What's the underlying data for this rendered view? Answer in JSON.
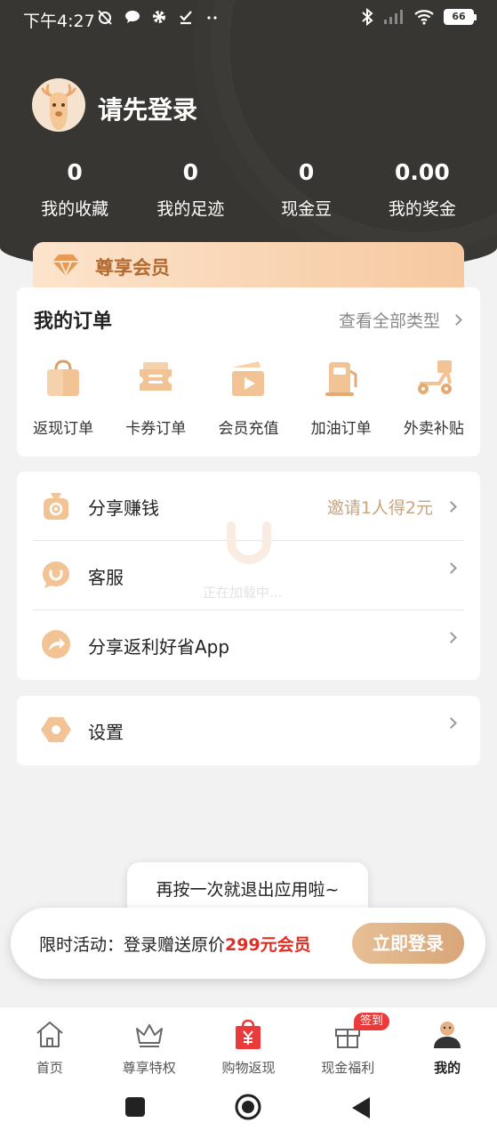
{
  "status_bar": {
    "time": "下午4:27",
    "battery": "66"
  },
  "profile": {
    "login_prompt": "请先登录"
  },
  "stats": [
    {
      "value": "0",
      "label": "我的收藏"
    },
    {
      "value": "0",
      "label": "我的足迹"
    },
    {
      "value": "0",
      "label": "现金豆"
    },
    {
      "value": "0.00",
      "label": "我的奖金"
    }
  ],
  "vip": {
    "label": "尊享会员"
  },
  "orders": {
    "title": "我的订单",
    "view_all": "查看全部类型",
    "items": [
      {
        "label": "返现订单",
        "icon": "shopping-bag-icon"
      },
      {
        "label": "卡券订单",
        "icon": "coupon-icon"
      },
      {
        "label": "会员充值",
        "icon": "video-play-icon"
      },
      {
        "label": "加油订单",
        "icon": "fuel-pump-icon"
      },
      {
        "label": "外卖补贴",
        "icon": "delivery-scooter-icon"
      }
    ]
  },
  "menu": {
    "share_earn": {
      "label": "分享赚钱",
      "hint": "邀请1人得2元"
    },
    "customer_service": {
      "label": "客服"
    },
    "share_app": {
      "label": "分享返利好省App"
    },
    "settings": {
      "label": "设置"
    }
  },
  "loading": {
    "text": "正在加载中..."
  },
  "toast": {
    "text": "再按一次就退出应用啦~"
  },
  "promo": {
    "text_prefix": "限时活动：登录赠送原价",
    "text_highlight": "299元会员",
    "button": "立即登录"
  },
  "tabbar": {
    "items": [
      {
        "label": "首页",
        "icon": "home-icon"
      },
      {
        "label": "尊享特权",
        "icon": "crown-icon"
      },
      {
        "label": "购物返现",
        "icon": "yen-bag-icon"
      },
      {
        "label": "现金福利",
        "icon": "gift-icon"
      },
      {
        "label": "我的",
        "icon": "user-icon"
      }
    ],
    "badge": "签到"
  },
  "colors": {
    "header_bg": "#383632",
    "accent_gold": "#d8a679",
    "highlight_red": "#e02e24"
  }
}
